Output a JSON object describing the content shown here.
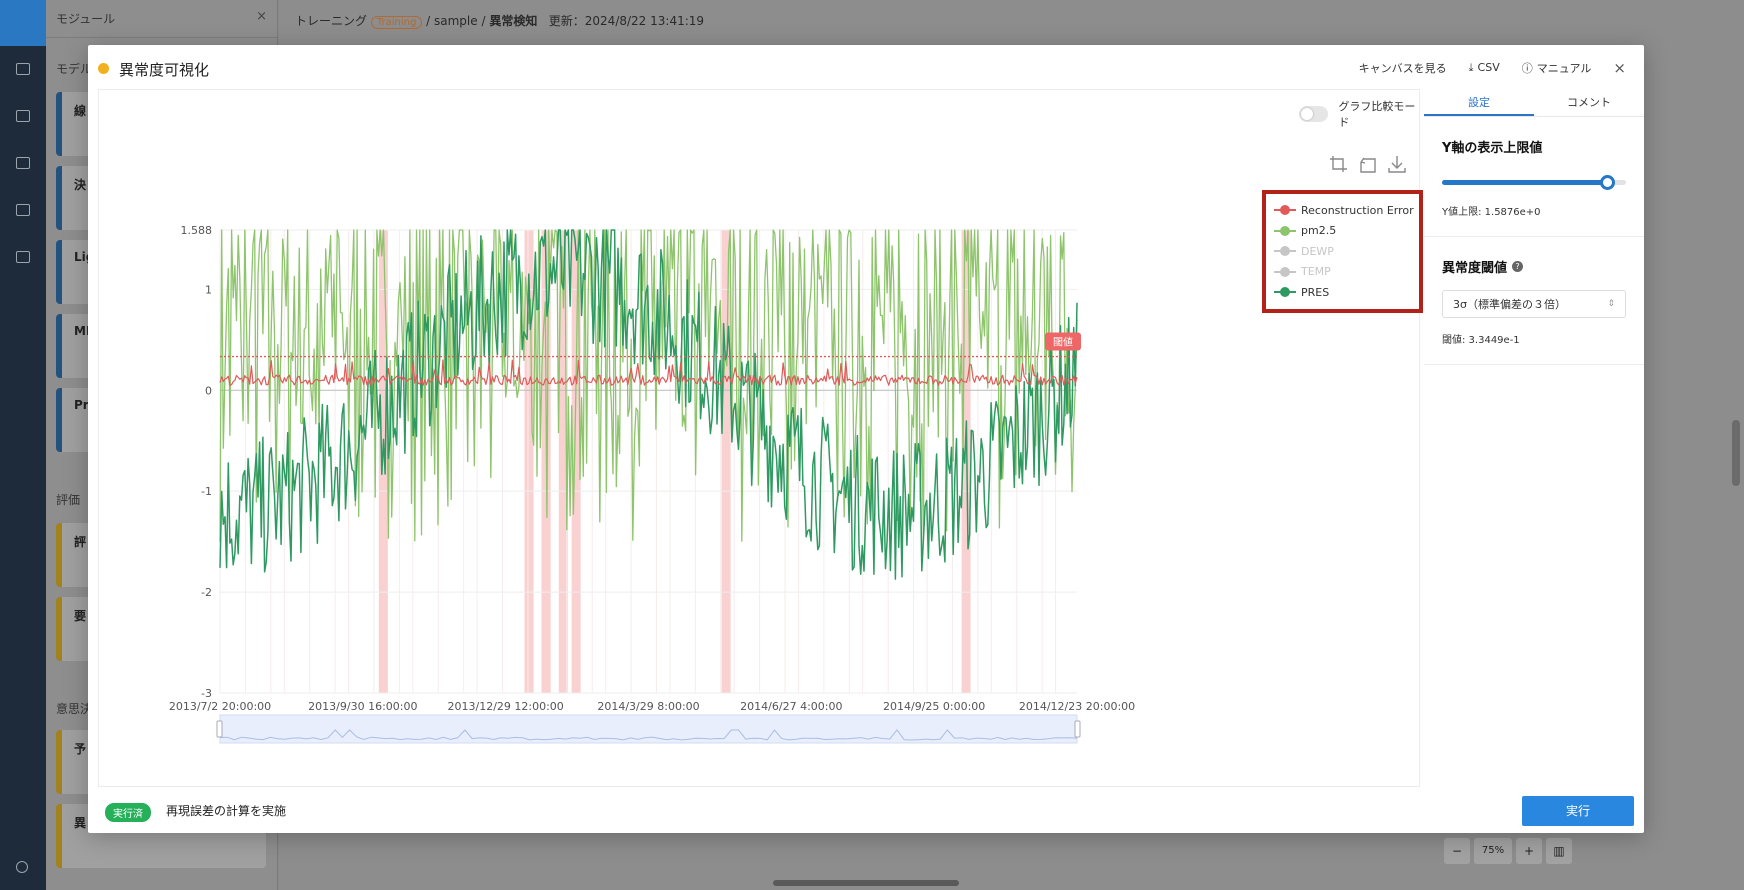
{
  "background": {
    "panel_title": "モジュール",
    "section_model": "モデル",
    "model_cards": [
      "線",
      "決",
      "Lig",
      "MI",
      "Pro"
    ],
    "section_eval": "評価",
    "eval_cards": [
      "評",
      "要"
    ],
    "section_decision": "意思決",
    "decision_cards": [
      "予",
      "異"
    ],
    "breadcrumb": {
      "root": "トレーニング",
      "badge": "Training",
      "path": "/ sample /",
      "current": "異常検知",
      "updated": "更新：2024/8/22 13:41:19"
    },
    "zoom": {
      "minus": "−",
      "level": "75%",
      "plus": "+"
    }
  },
  "modal": {
    "title": "異常度可視化",
    "actions": {
      "canvas": "キャンバスを見る",
      "csv": "CSV",
      "manual": "マニュアル",
      "close": "×"
    },
    "compare_mode_label": "グラフ比較モード",
    "tabs": [
      "設定",
      "コメント"
    ],
    "y_limit": {
      "heading": "Y軸の表示上限値",
      "slider_fraction": 0.9,
      "value_text": "Y値上限: 1.5876e+0"
    },
    "threshold": {
      "heading": "異常度閾値",
      "help": "?",
      "selected": "3σ（標準偏差の３倍）",
      "value_text": "閾値: 3.3449e-1"
    },
    "status": {
      "badge": "実行済",
      "text": "再現誤差の計算を実施"
    },
    "run_button": "実行"
  },
  "chart_data": {
    "type": "line",
    "y_ticks": [
      "1.588",
      "1",
      "0",
      "-1",
      "-2",
      "-3"
    ],
    "ylim": [
      -3,
      1.588
    ],
    "x_ticks": [
      "2013/7/2 20:00:00",
      "2013/9/30 16:00:00",
      "2013/12/29 12:00:00",
      "2014/3/29 8:00:00",
      "2014/6/27 4:00:00",
      "2014/9/25 0:00:00",
      "2014/12/23 20:00:00"
    ],
    "threshold_label": "閾値",
    "threshold_value": 0.334,
    "legend": [
      {
        "name": "Reconstruction Error",
        "color": "#e05a5a",
        "visible": true
      },
      {
        "name": "pm2.5",
        "color": "#8dc46c",
        "visible": true
      },
      {
        "name": "DEWP",
        "color": "#c8c8c8",
        "visible": false
      },
      {
        "name": "TEMP",
        "color": "#c8c8c8",
        "visible": false
      },
      {
        "name": "PRES",
        "color": "#2e9a62",
        "visible": true
      }
    ],
    "anomaly_band_fractions": [
      0.19,
      0.36,
      0.38,
      0.4,
      0.415,
      0.59,
      0.87
    ]
  }
}
